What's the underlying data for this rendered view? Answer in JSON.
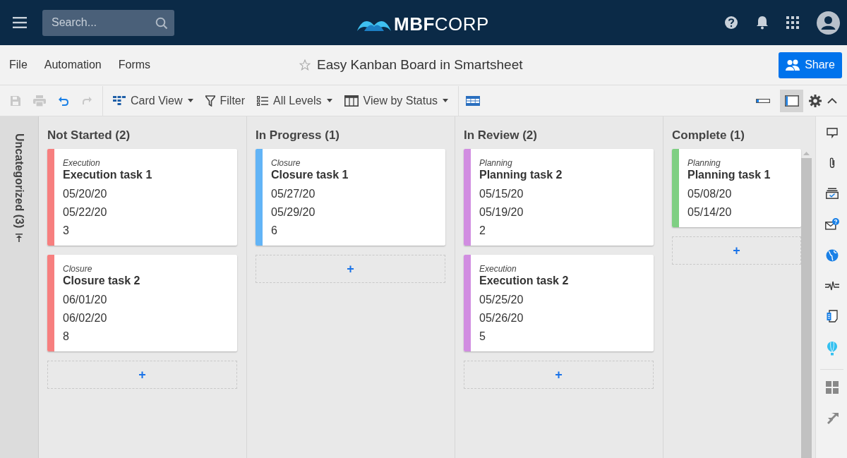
{
  "top_bar": {
    "search": {
      "placeholder": "Search..."
    },
    "logo": "**MBF**CORP"
  },
  "menu": [
    {
      "label": "File"
    },
    {
      "label": "Automation"
    },
    {
      "label": "Forms"
    }
  ],
  "sheet_title": "Easy Kanban Board in Smartsheet",
  "share_button": "Share",
  "toolbar": {
    "view": "Card View",
    "filter": "Filter",
    "levels": "All Levels",
    "group": "View by Status",
    "layouts": [
      {
        "kind": "compact",
        "selected": false
      },
      {
        "kind": "full",
        "selected": true
      }
    ]
  },
  "uncategorized": {
    "label": "Uncategorized (3)"
  },
  "columns": [
    {
      "title": "Not Started (2)",
      "add": "+",
      "cards": [
        {
          "category": "Execution",
          "title": "Execution task 1",
          "fields": [
            "05/20/20",
            "05/22/20",
            "3"
          ],
          "color": "#f77f7f"
        },
        {
          "category": "Closure",
          "title": "Closure task 2",
          "fields": [
            "06/01/20",
            "06/02/20",
            "8"
          ],
          "color": "#f77f7f"
        }
      ]
    },
    {
      "title": "In Progress (1)",
      "add": "+",
      "cards": [
        {
          "category": "Closure",
          "title": "Closure task 1",
          "fields": [
            "05/27/20",
            "05/29/20",
            "6"
          ],
          "color": "#62b4f6"
        }
      ]
    },
    {
      "title": "In Review (2)",
      "add": "+",
      "cards": [
        {
          "category": "Planning",
          "title": "Planning task 2",
          "fields": [
            "05/15/20",
            "05/19/20",
            "2"
          ],
          "color": "#d18de1"
        },
        {
          "category": "Execution",
          "title": "Execution task 2",
          "fields": [
            "05/25/20",
            "05/26/20",
            "5"
          ],
          "color": "#d18de1"
        }
      ]
    },
    {
      "title": "Complete (1)",
      "add": "+",
      "cards": [
        {
          "category": "Planning",
          "title": "Planning task 1",
          "fields": [
            "05/08/20",
            "05/14/20"
          ],
          "color": "#7fcf83"
        }
      ]
    }
  ]
}
